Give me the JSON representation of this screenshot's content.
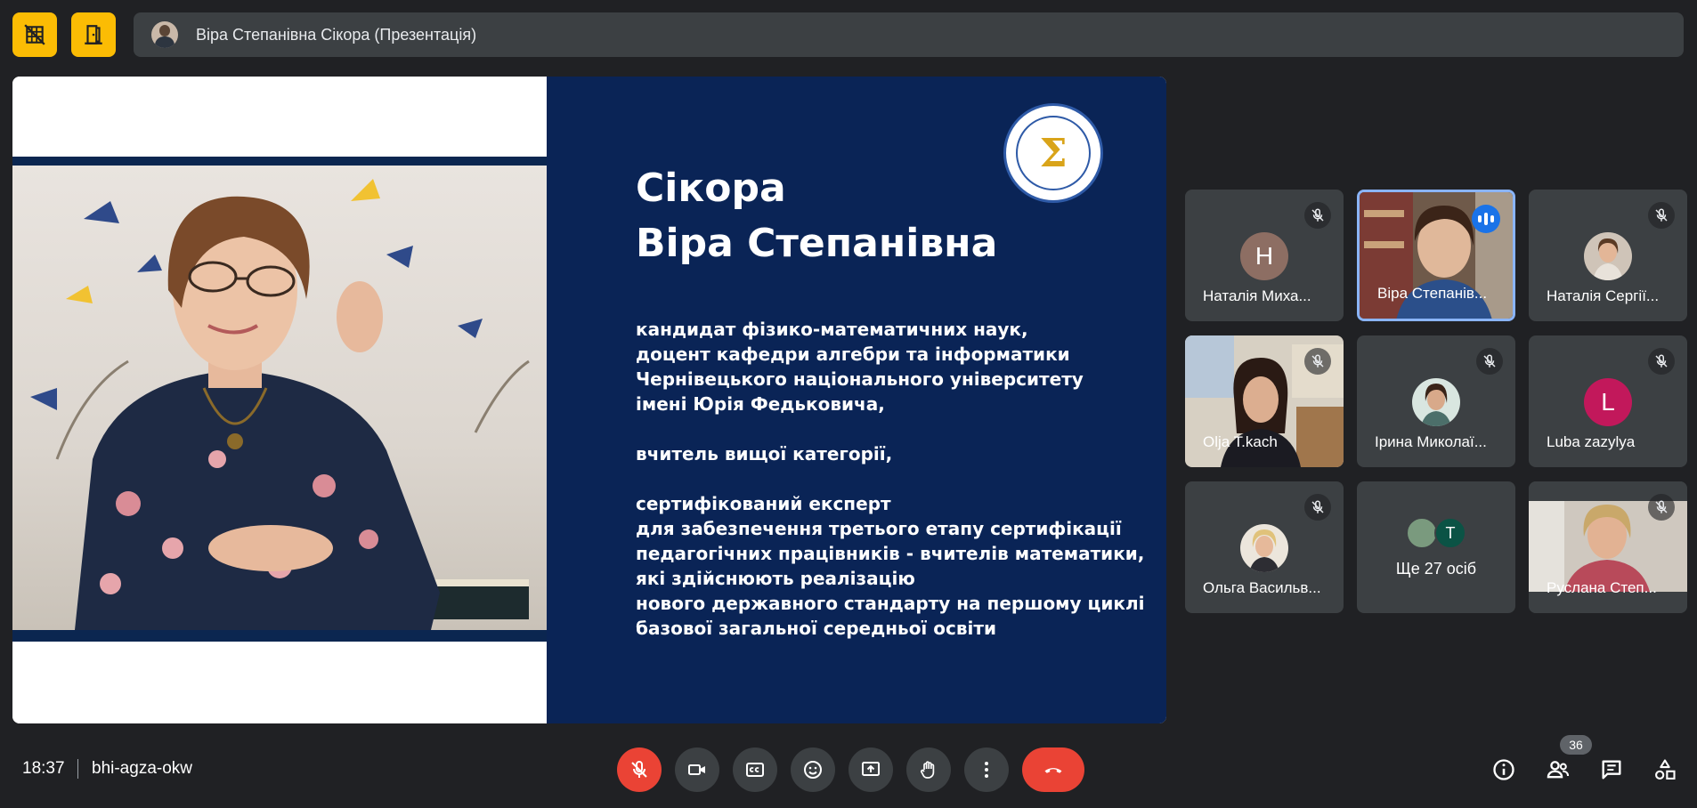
{
  "header": {
    "title": "Віра Степанівна Сікора (Презентація)"
  },
  "slide": {
    "name_line1": "Сікора",
    "name_line2": "Віра Степанівна",
    "body": "кандидат фізико-математичних наук,\nдоцент кафедри алгебри та інформатики\nЧернівецького національного університету\nімені Юрія Федьковича,\n\nвчитель вищої категорії,\n\nсертифікований експерт\nдля забезпечення третього етапу сертифікації\nпедагогічних працівників - вчителів математики,\nякі здійснюють реалізацію\nнового державного стандарту на першому циклі\nбазової загальної середньої освіти",
    "logo_symbol": "Σ",
    "accent": "#0a2456"
  },
  "participants": [
    {
      "name": "Наталія Миха...",
      "avatar": "Н",
      "avatar_color": "#8d6e63"
    },
    {
      "name": "Віра Степанів..."
    },
    {
      "name": "Наталія Сергії..."
    },
    {
      "name": "Olja T.kach"
    },
    {
      "name": "Ірина Миколаї..."
    },
    {
      "name": "Luba zazylya",
      "avatar": "L",
      "avatar_color": "#c2185b"
    },
    {
      "name": "Ольга Васильв..."
    },
    {
      "more_text": "Ще 27 осіб",
      "avatar_letter": "T"
    },
    {
      "name": "Руслана Степ..."
    }
  ],
  "footer": {
    "time": "18:37",
    "meeting_code": "bhi-agza-okw",
    "participant_count": "36"
  },
  "colors": {
    "background": "#202124",
    "tile": "#3c4043",
    "danger": "#ea4335",
    "highlight": "#fbbc04",
    "active_border": "#8ab4f8"
  }
}
